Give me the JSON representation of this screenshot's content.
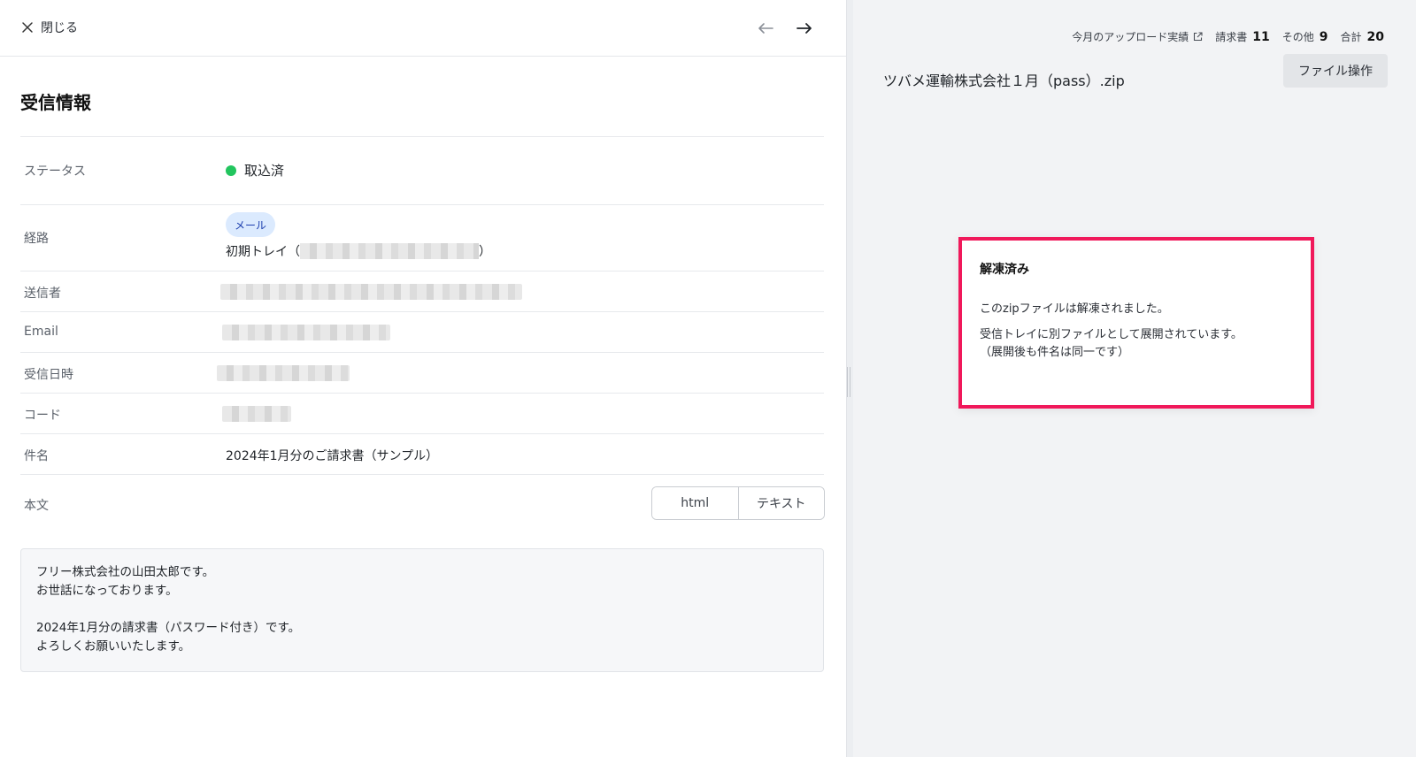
{
  "header": {
    "close_label": "閉じる"
  },
  "detail": {
    "section_title": "受信情報",
    "rows": {
      "status": {
        "label": "ステータス",
        "value": "取込済"
      },
      "route": {
        "label": "経路",
        "badge": "メール",
        "text_prefix": "初期トレイ（",
        "text_suffix": "）"
      },
      "sender": {
        "label": "送信者"
      },
      "email": {
        "label": "Email"
      },
      "received_at": {
        "label": "受信日時"
      },
      "code": {
        "label": "コード"
      },
      "subject": {
        "label": "件名",
        "value": "2024年1月分のご請求書（サンプル）"
      },
      "body": {
        "label": "本文"
      }
    },
    "body_toggle": {
      "html_label": "html",
      "text_label": "テキスト"
    },
    "mail_body_lines": [
      "フリー株式会社の山田太郎です。",
      "お世話になっております。",
      "",
      "2024年1月分の請求書（パスワード付き）です。",
      "よろしくお願いいたします。"
    ]
  },
  "preview": {
    "stats": {
      "upload_link": "今月のアップロード実績",
      "invoice_label": "請求書",
      "invoice_count": "11",
      "other_label": "その他",
      "other_count": "9",
      "total_label": "合計",
      "total_count": "20"
    },
    "file_name": "ツバメ運輸株式会社１月（pass）.zip",
    "file_action_label": "ファイル操作",
    "notice": {
      "title": "解凍済み",
      "line1": "このzipファイルは解凍されました。",
      "line2": "受信トレイに別ファイルとして展開されています。",
      "line3": "（展開後も件名は同一です）"
    }
  },
  "colors": {
    "status_ok": "#22c55e",
    "notice_border": "#f0185a",
    "badge_bg": "#dbeafe"
  }
}
